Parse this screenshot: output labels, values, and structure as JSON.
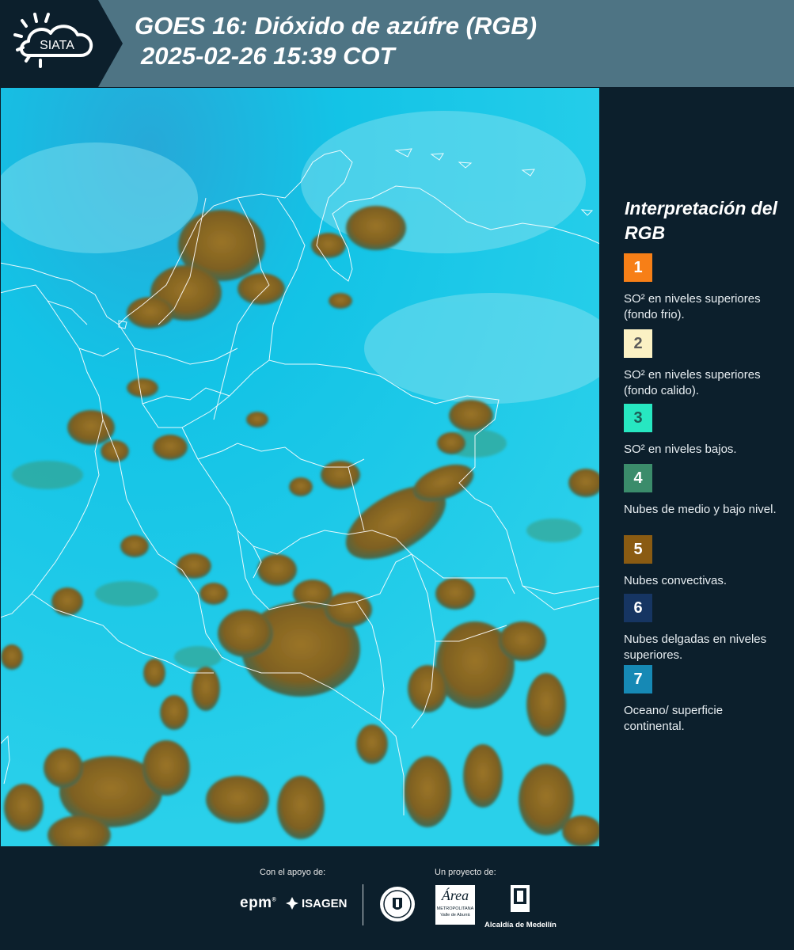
{
  "header": {
    "logo_text": "SIATA",
    "title_line1": "GOES 16: Dióxido de azúfre (RGB)",
    "title_line2": "2025-02-26 15:39 COT"
  },
  "map": {
    "layer": "RGB Dióxido de azúfre",
    "colors": {
      "surface": "#12c6e8",
      "convective": "#8c6a22",
      "lowcloud": "#2f8f7a",
      "borders": "#ffffff"
    }
  },
  "legend": {
    "title": "Interpretación del RGB",
    "items": [
      {
        "number": "1",
        "color": "#f77f17",
        "number_color": "#ffffff",
        "description": "SO² en niveles superiores (fondo frio)."
      },
      {
        "number": "2",
        "color": "#fbf1c4",
        "number_color": "#5a5a5a",
        "description": "SO² en niveles superiores (fondo calido)."
      },
      {
        "number": "3",
        "color": "#27e7c1",
        "number_color": "#1b5c55",
        "description": "SO² en niveles bajos."
      },
      {
        "number": "4",
        "color": "#3b8c6b",
        "number_color": "#ffffff",
        "description": "Nubes de medio y bajo nivel."
      },
      {
        "number": "5",
        "color": "#8a5b12",
        "number_color": "#ffffff",
        "description": "Nubes convectivas."
      },
      {
        "number": "6",
        "color": "#163562",
        "number_color": "#ffffff",
        "description": "Nubes delgadas en niveles superiores."
      },
      {
        "number": "7",
        "color": "#1689b5",
        "number_color": "#ffffff",
        "description": "Oceano/ superficie continental."
      }
    ]
  },
  "footer": {
    "support_label": "Con el apoyo de:",
    "project_label": "Un proyecto de:",
    "sponsors": [
      "epm",
      "ISAGEN"
    ],
    "partners": [
      "Área Metropolitana Valle de Aburrá",
      "Alcaldía de Medellín"
    ],
    "area_logo_text": "Área",
    "area_sub1": "METROPOLITANA",
    "area_sub2": "Valle de Aburrá",
    "alcaldia_label": "Alcaldía de Medellín"
  }
}
